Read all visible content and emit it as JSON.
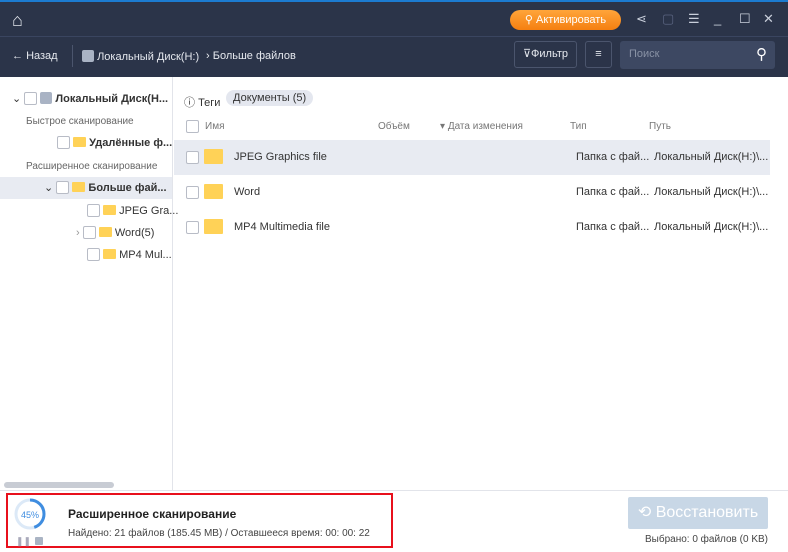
{
  "titlebar": {
    "activate_label": "Активировать",
    "icons": [
      "home-icon",
      "share-icon",
      "upload-icon",
      "menu-icon",
      "minimize-icon",
      "maximize-icon",
      "close-icon"
    ]
  },
  "nav": {
    "back": "Назад",
    "crumbs": [
      "Локальный Диск(H:)",
      "Больше файлов"
    ],
    "filter": "Фильтр",
    "search_placeholder": "Поиск"
  },
  "sidebar": {
    "root": "Локальный Диск(H...",
    "quick": "Быстрое сканирование",
    "deleted": "Удалённые ф...",
    "advanced": "Расширенное сканирование",
    "more": "Больше фай...",
    "children": [
      "JPEG Gra...",
      "Word(5)",
      "MP4 Mul..."
    ]
  },
  "main": {
    "tags": "Теги",
    "docs_chip": "Документы (5)",
    "columns": {
      "name": "Имя",
      "size": "Объём",
      "date": "Дата изменения",
      "type": "Тип",
      "path": "Путь"
    },
    "rows": [
      {
        "name": "JPEG Graphics file",
        "type": "Папка с фай...",
        "path": "Локальный Диск(H:)\\..."
      },
      {
        "name": "Word",
        "type": "Папка с фай...",
        "path": "Локальный Диск(H:)\\..."
      },
      {
        "name": "MP4 Multimedia file",
        "type": "Папка с фай...",
        "path": "Локальный Диск(H:)\\..."
      }
    ]
  },
  "status": {
    "percent": "45%",
    "progress": 0.45,
    "title": "Расширенное сканирование",
    "detail": "Найдено: 21 файлов (185.45 MB) / Оставшееся время: 00: 00: 22",
    "restore": "Восстановить",
    "selected": "Выбрано: 0 файлов  (0 KB)"
  },
  "colors": {
    "header": "#2b3449",
    "accent": "#f57f10",
    "highlight": "#e8101c"
  }
}
